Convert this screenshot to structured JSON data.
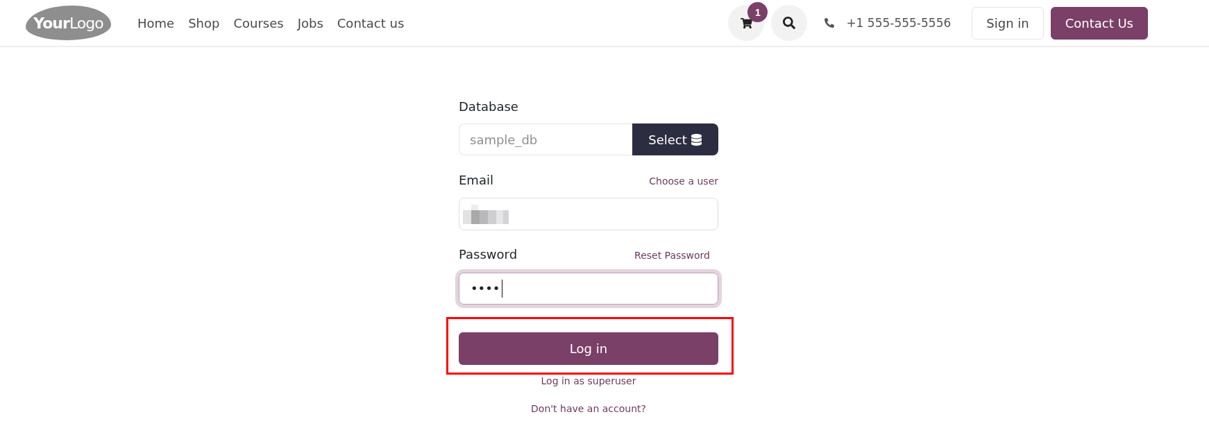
{
  "header": {
    "logo": "**Your**Logo",
    "nav": [
      "Home",
      "Shop",
      "Courses",
      "Jobs",
      "Contact us"
    ],
    "cart": {
      "count": "1"
    },
    "phone": "+1 555-555-5556",
    "buttons": [
      {
        "label": "Sign in",
        "kind": "outline"
      },
      {
        "label": "Contact Us",
        "kind": "primary"
      }
    ]
  },
  "form": {
    "database": {
      "label": "Database",
      "placeholder": "sample_db",
      "button": "Select"
    },
    "email": {
      "label": "Email",
      "link": "Choose a user",
      "redacted": true
    },
    "password": {
      "label": "Password",
      "link": "Reset Password",
      "value": "••••",
      "focused": true
    },
    "submit": {
      "label": "Log in",
      "highlighted": true
    },
    "links": [
      "Log in as superuser",
      "Don't have an account?"
    ]
  }
}
